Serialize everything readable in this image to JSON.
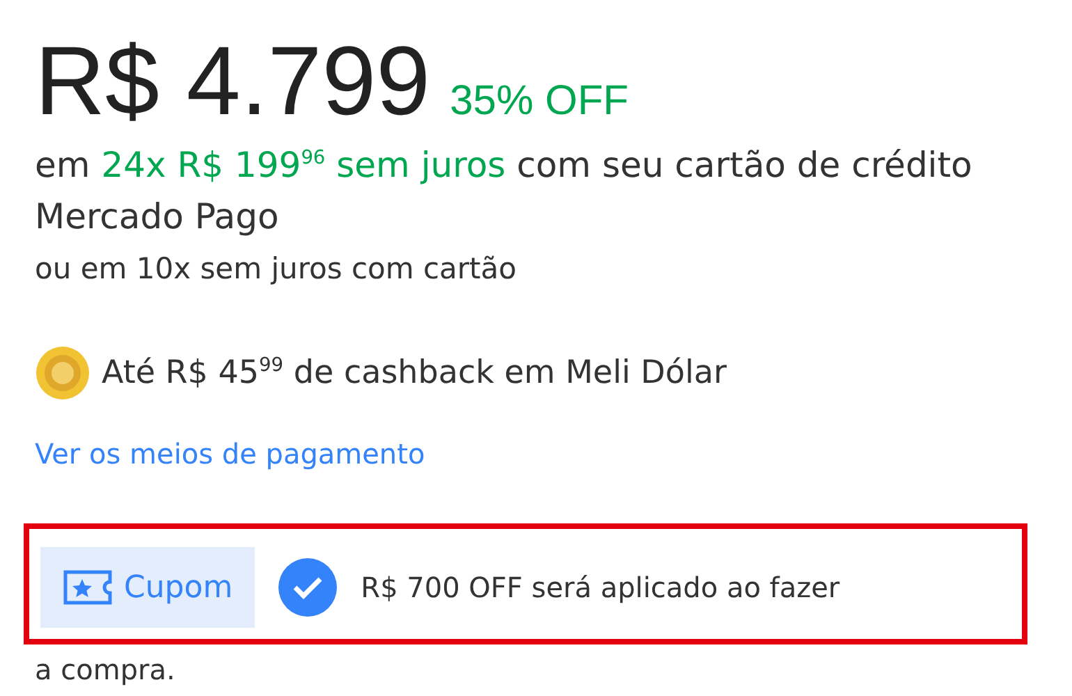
{
  "price": {
    "amount": "R$ 4.799",
    "discount": "35% OFF"
  },
  "installments": {
    "prefix": "em",
    "highlight": "24x R$ 199$^{96}$ sem juros",
    "suffix": "com seu cartão de crédito Mercado Pago"
  },
  "alt_installments": "ou em 10x sem juros com cartão",
  "cashback": "Até R$ 45$^{99}$ de cashback em Meli Dólar",
  "payment_link": "Ver os meios de pagamento",
  "coupon": {
    "button": "Cupom",
    "applied": true,
    "message": "R$ 700 OFF será aplicado ao fazer",
    "message_continued": "a compra."
  }
}
